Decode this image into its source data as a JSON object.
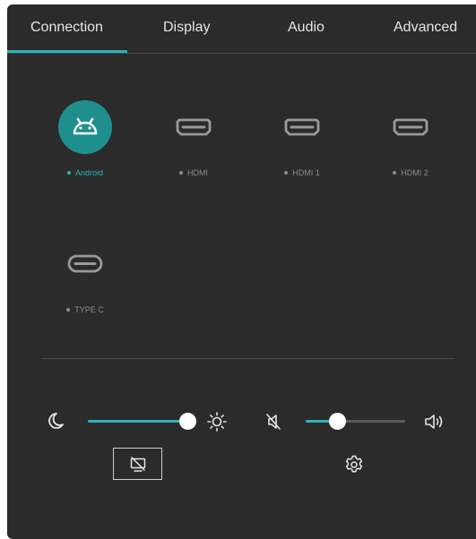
{
  "tabs": [
    {
      "label": "Connection",
      "active": true
    },
    {
      "label": "Display",
      "active": false
    },
    {
      "label": "Audio",
      "active": false
    },
    {
      "label": "Advanced",
      "active": false
    }
  ],
  "sources": [
    {
      "label": "Android",
      "icon": "android-icon",
      "active": true
    },
    {
      "label": "HDMI",
      "icon": "hdmi-port-icon",
      "active": false
    },
    {
      "label": "HDMI 1",
      "icon": "hdmi-port-icon",
      "active": false
    },
    {
      "label": "HDMI 2",
      "icon": "hdmi-port-icon",
      "active": false
    },
    {
      "label": "TYPE C",
      "icon": "usb-c-port-icon",
      "active": false
    }
  ],
  "controls": {
    "brightness": {
      "level_percent": 100,
      "min_icon": "moon-icon",
      "max_icon": "sun-icon"
    },
    "volume": {
      "level_percent": 32,
      "min_icon": "mute-icon",
      "max_icon": "speaker-icon"
    },
    "screen_off_icon": "screen-off-icon",
    "settings_icon": "gear-icon"
  },
  "colors": {
    "panel_background": "#2b2b2b",
    "accent": "#2ab3b6",
    "active_source_circle": "#1f8f8e",
    "text_primary": "#e6e6e6",
    "text_muted": "#8c8c8c"
  }
}
